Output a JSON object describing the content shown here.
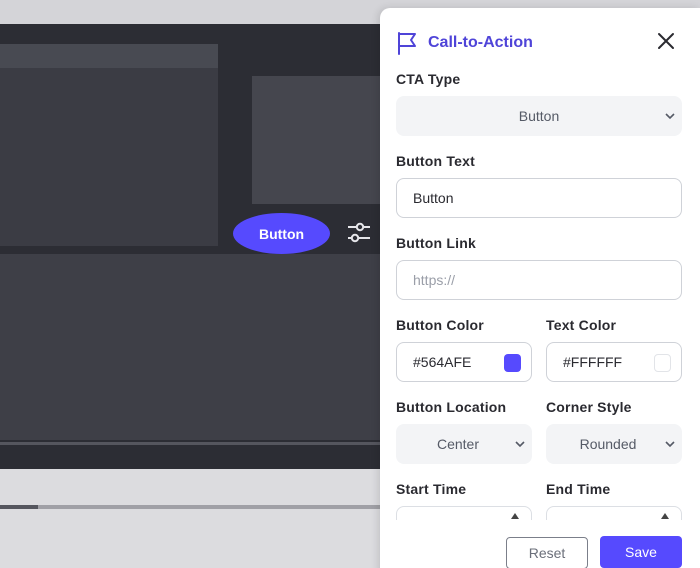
{
  "preview": {
    "cta_label": "Button",
    "cta_color": "#564AFE",
    "progress_fraction": 0.1
  },
  "panel": {
    "title": "Call-to-Action",
    "accent_color": "#564AFE",
    "cta_type": {
      "label": "CTA Type",
      "value": "Button"
    },
    "button_text": {
      "label": "Button Text",
      "value": "Button"
    },
    "button_link": {
      "label": "Button Link",
      "placeholder": "https://"
    },
    "button_color": {
      "label": "Button Color",
      "value": "#564AFE"
    },
    "text_color": {
      "label": "Text Color",
      "value": "#FFFFFF"
    },
    "button_location": {
      "label": "Button Location",
      "value": "Center"
    },
    "corner_style": {
      "label": "Corner Style",
      "value": "Rounded"
    },
    "start_time": {
      "label": "Start Time"
    },
    "end_time": {
      "label": "End Time"
    },
    "reset_label": "Reset",
    "save_label": "Save"
  }
}
